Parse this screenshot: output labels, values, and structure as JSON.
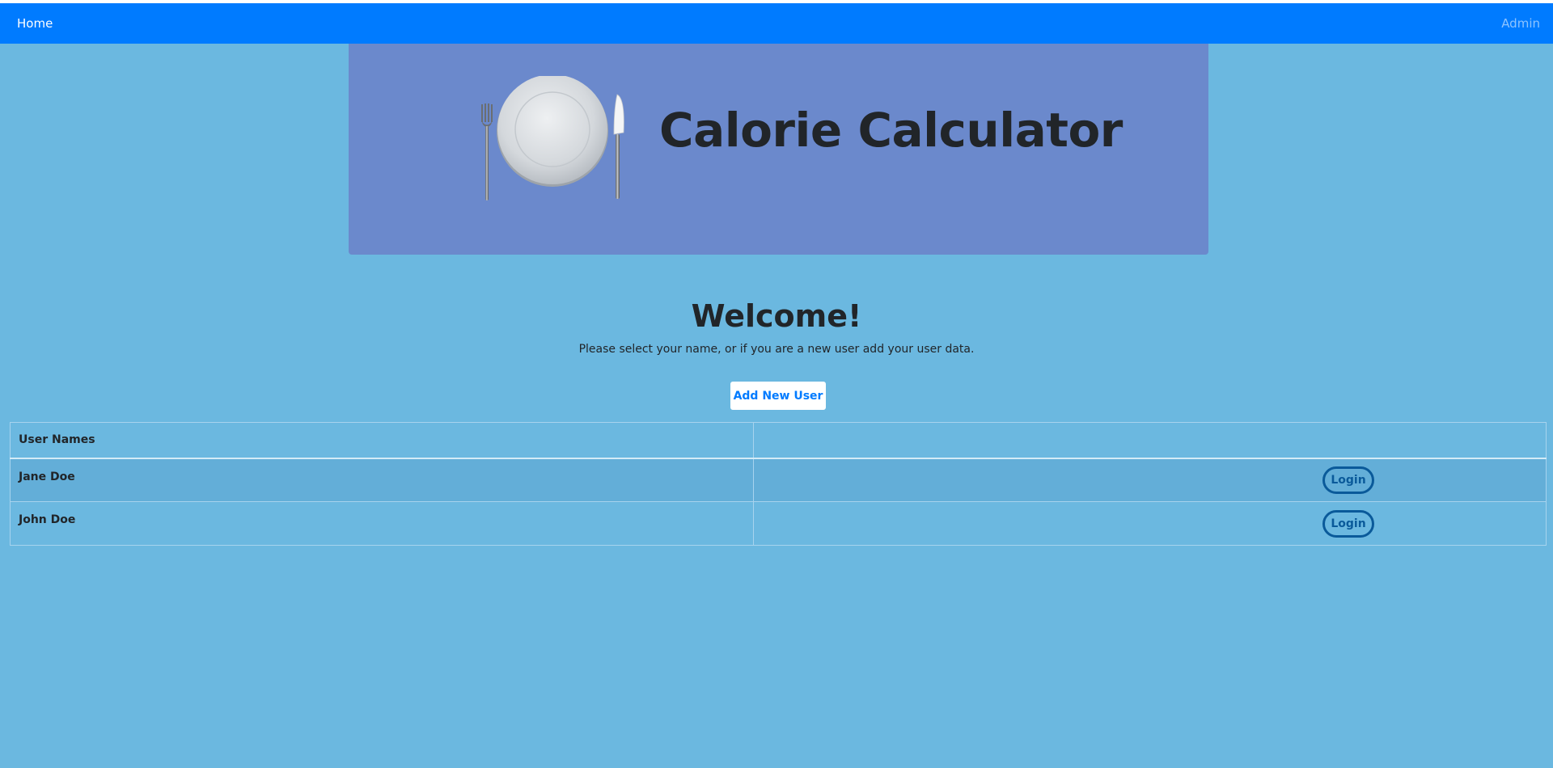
{
  "nav": {
    "home_label": "Home",
    "admin_label": "Admin"
  },
  "banner": {
    "title": "Calorie Calculator",
    "art_icon": "plate-fork-knife-icon"
  },
  "welcome": {
    "heading": "Welcome!",
    "subtitle": "Please select your name, or if you are a new user add your user data.",
    "add_button_label": "Add New User"
  },
  "table": {
    "headers": [
      "User Names",
      ""
    ],
    "rows": [
      {
        "name": "Jane Doe",
        "action": "Login"
      },
      {
        "name": "John Doe",
        "action": "Login"
      }
    ]
  },
  "colors": {
    "navbar": "#007bff",
    "page_background": "#6bb8e0",
    "banner_background": "#6b89cc",
    "login_outline": "#0a5a9a"
  }
}
